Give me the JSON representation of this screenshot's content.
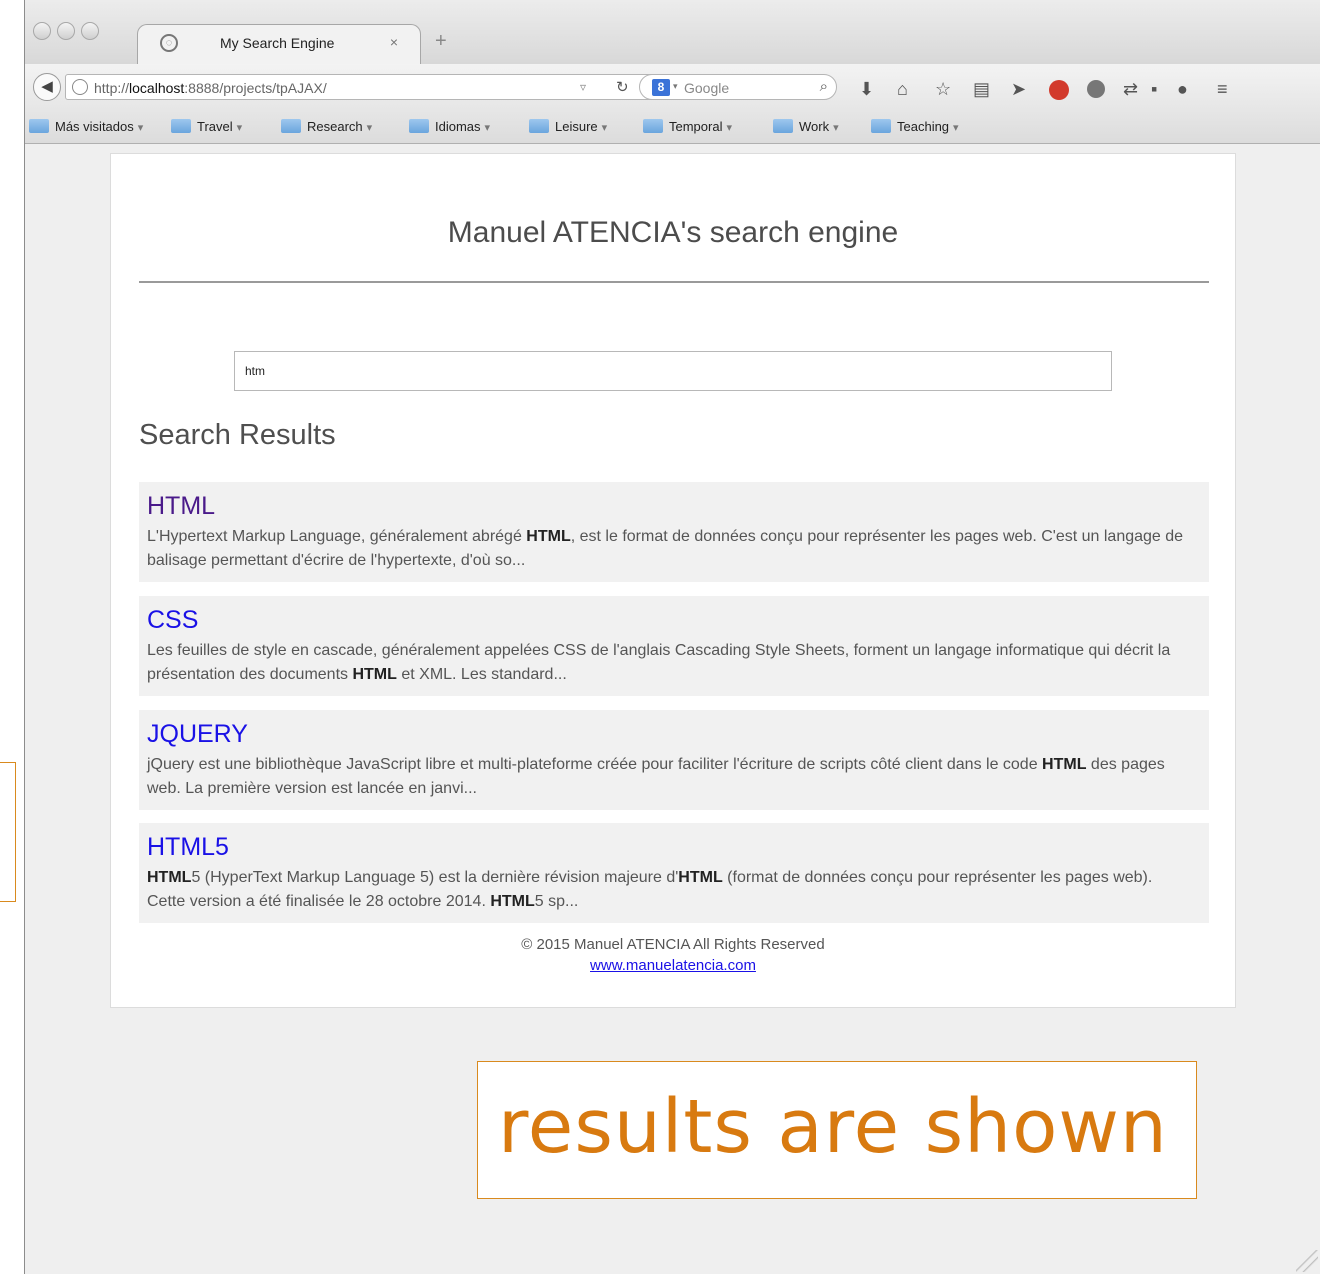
{
  "browser": {
    "tab_title": "My Search Engine",
    "tab_close": "×",
    "new_tab": "+",
    "url_prefix": "http://",
    "url_host": "localhost",
    "url_rest": ":8888/projects/tpAJAX/",
    "search_engine": "Google",
    "bookmarks": [
      {
        "label": "Más visitados"
      },
      {
        "label": "Travel"
      },
      {
        "label": "Research"
      },
      {
        "label": "Idiomas"
      },
      {
        "label": "Leisure"
      },
      {
        "label": "Temporal"
      },
      {
        "label": "Work"
      },
      {
        "label": "Teaching"
      }
    ]
  },
  "page": {
    "title": "Manuel ATENCIA's search engine",
    "query": "htm",
    "results_heading": "Search Results",
    "results": [
      {
        "title": "HTML",
        "snippet_parts": [
          "L'Hypertext Markup Language, généralement abrégé ",
          "HTML",
          ", est le format de données conçu pour représenter les pages web. C'est un langage de balisage permettant d'écrire de l'hypertexte, d'où so..."
        ]
      },
      {
        "title": "CSS",
        "snippet_parts": [
          "Les feuilles de style en cascade, généralement appelées CSS de l'anglais Cascading Style Sheets, forment un langage informatique qui décrit la présentation des documents ",
          "HTML",
          " et XML. Les standard..."
        ]
      },
      {
        "title": "JQUERY",
        "snippet_parts": [
          "jQuery est une bibliothèque JavaScript libre et multi-plateforme créée pour faciliter l'écriture de scripts côté client dans le code ",
          "HTML",
          " des pages web. La première version est lancée en janvi..."
        ]
      },
      {
        "title": "HTML5",
        "snippet_parts": [
          "",
          "HTML",
          "5 (HyperText Markup Language 5) est la dernière révision majeure d'",
          "HTML",
          " (format de données conçu pour représenter les pages web). Cette version a été finalisée le 28 octobre 2014. ",
          "HTML",
          "5 sp..."
        ]
      }
    ],
    "footer_text": "© 2015 Manuel ATENCIA All Rights Reserved",
    "footer_link": "www.manuelatencia.com"
  },
  "annotation": {
    "callout": "results are shown"
  },
  "colors": {
    "link": "#1a11e6",
    "visited_link": "#4a1a8a",
    "annotation": "#d87a10"
  }
}
